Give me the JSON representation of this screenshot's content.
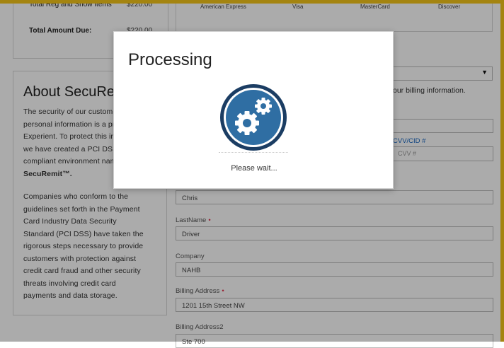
{
  "summary": {
    "row1_label": "Total Reg and Show Items",
    "row1_amount": "$220.00",
    "row2_label": "Total Amount Due:",
    "row2_amount": "$220.00"
  },
  "about": {
    "title": "About SecuRemit",
    "paragraph1_lines": [
      "The security of our customers'",
      "personal information is a priority for",
      "Experient. To protect this information,",
      "we have created a PCI DSS",
      "compliant environment named"
    ],
    "product_name": "SecuRemit™.",
    "paragraph2_lines": [
      "Companies who conform to the",
      "guidelines set forth in the Payment",
      "Card Industry Data Security",
      "Standard (PCI DSS) have taken the",
      "rigorous steps necessary to provide",
      "customers with protection against",
      "credit card fraud and other security",
      "threats involving credit card",
      "payments and data storage."
    ]
  },
  "payment": {
    "cards": [
      "American Express",
      "Visa",
      "MasterCard",
      "Discover"
    ],
    "billing_info_text": "our billing information.",
    "cvv_label": "CVV/CID #",
    "cvv_placeholder": "CVV #",
    "firstname_value": "Chris",
    "lastname_label": "LastName",
    "lastname_value": "Driver",
    "company_label": "Company",
    "company_value": "NAHB",
    "billing_address_label": "Billing Address",
    "billing_address_value": "1201 15th Street NW",
    "billing_address2_label": "Billing Address2",
    "billing_address2_value": "Ste 700",
    "required_marker": "•"
  },
  "modal": {
    "title": "Processing",
    "icon": "gears-icon",
    "message": "Please wait..."
  },
  "colors": {
    "frame_border": "#f5c518",
    "gears_circle": "#2f6ea3",
    "gears_ring": "#1b3d63",
    "required": "#e0324b",
    "link": "#1565c0"
  }
}
